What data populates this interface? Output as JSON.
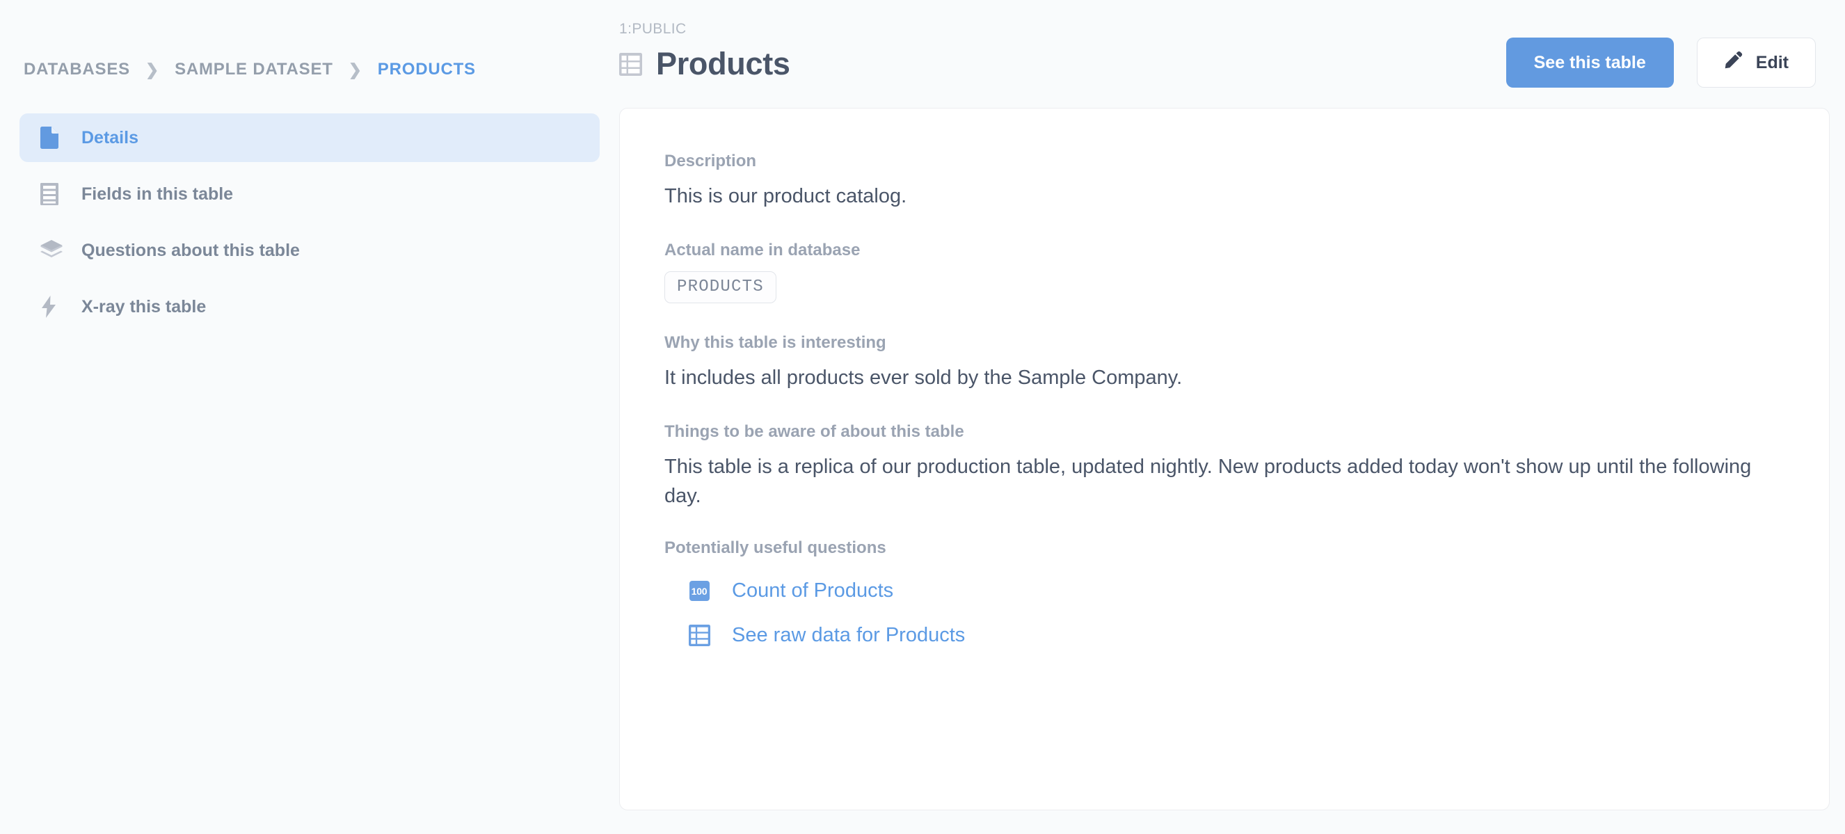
{
  "breadcrumb": {
    "items": [
      {
        "label": "DATABASES",
        "active": false
      },
      {
        "label": "SAMPLE DATASET",
        "active": false
      },
      {
        "label": "PRODUCTS",
        "active": true
      }
    ],
    "separator": "❯"
  },
  "sidebar": {
    "items": [
      {
        "label": "Details",
        "icon": "document-icon",
        "selected": true
      },
      {
        "label": "Fields in this table",
        "icon": "fields-list-icon",
        "selected": false
      },
      {
        "label": "Questions about this table",
        "icon": "layers-icon",
        "selected": false
      },
      {
        "label": "X-ray this table",
        "icon": "lightning-bolt-icon",
        "selected": false
      }
    ]
  },
  "header": {
    "schema": "1:PUBLIC",
    "title": "Products",
    "title_icon": "table-grid-icon",
    "see_table_label": "See this table",
    "edit_label": "Edit",
    "edit_icon": "pencil-icon"
  },
  "details": {
    "description_label": "Description",
    "description_value": "This is our product catalog.",
    "actual_name_label": "Actual name in database",
    "actual_name_value": "PRODUCTS",
    "interesting_label": "Why this table is interesting",
    "interesting_value": "It includes all products ever sold by the Sample Company.",
    "caveats_label": "Things to be aware of about this table",
    "caveats_value": "This table is a replica of our production table, updated nightly. New products added today won't show up until the following day.",
    "questions_label": "Potentially useful questions",
    "questions": [
      {
        "label": "Count of Products",
        "icon": "count-100-icon",
        "badge": "100"
      },
      {
        "label": "See raw data for Products",
        "icon": "table-grid-icon"
      }
    ]
  },
  "colors": {
    "accent_blue": "#5b9ae4",
    "primary_button": "#629ae0",
    "selected_nav_bg": "#e1ecfa",
    "text_dark": "#4a5568",
    "text_muted": "#9aa3b2",
    "page_bg": "#f9fbfc"
  }
}
